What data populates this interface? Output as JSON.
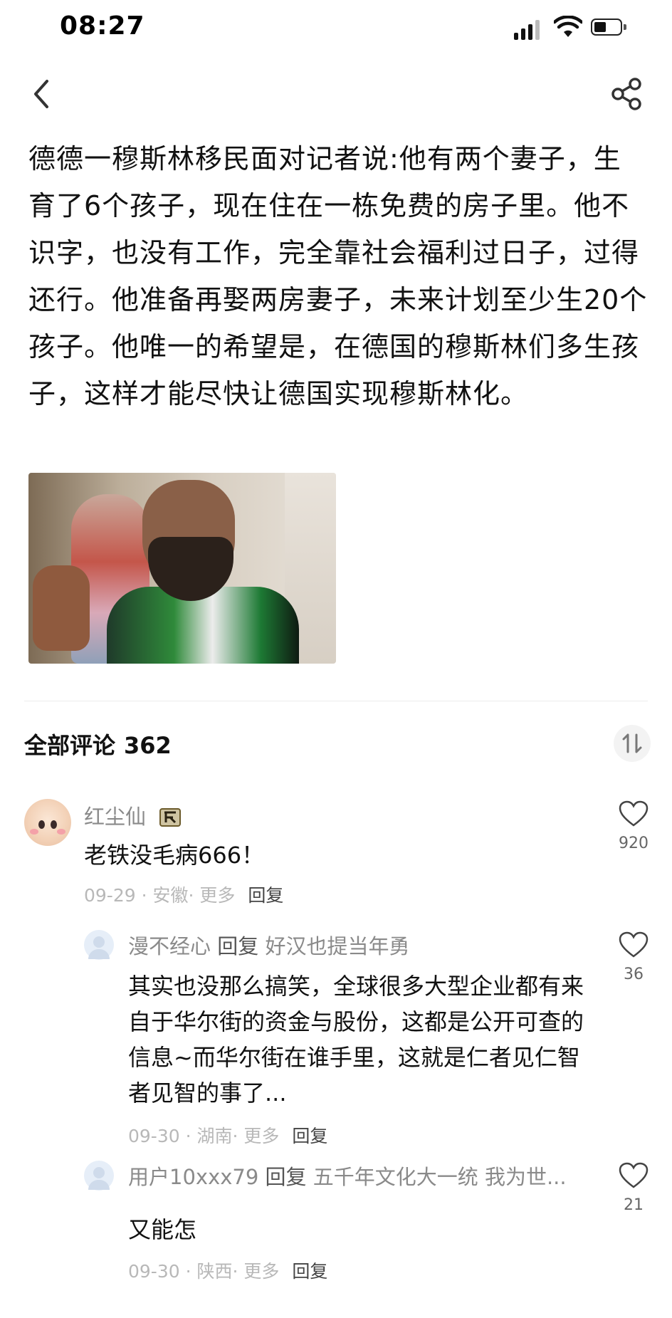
{
  "status_bar": {
    "time": "08:27"
  },
  "post": {
    "text": "德德一穆斯林移民面对记者说:他有两个妻子，生育了6个孩子，现在住在一栋免费的房子里。他不识字，也没有工作，完全靠社会福利过日子，过得还行。他准备再娶两房妻子，未来计划至少生20个孩子。他唯一的希望是，在德国的穆斯林们多生孩子，这样才能尽快让德国实现穆斯林化。"
  },
  "comments_header": {
    "label": "全部评论",
    "count": "362"
  },
  "comments": [
    {
      "user": "红尘仙",
      "text": "老铁没毛病666！",
      "date": "09-29",
      "location": "安徽",
      "more": "更多",
      "reply": "回复",
      "likes": "920"
    }
  ],
  "replies": [
    {
      "user": "漫不经心",
      "reply_word": "回复",
      "reply_to": "好汉也提当年勇",
      "text": "其实也没那么搞笑，全球很多大型企业都有来自于华尔街的资金与股份，这都是公开可查的信息~而华尔街在谁手里，这就是仁者见仁智者见智的事了...",
      "date": "09-30",
      "location": "湖南",
      "more": "更多",
      "reply": "回复",
      "likes": "36"
    },
    {
      "user": "用户10xxx79",
      "reply_word": "回复",
      "reply_to": "五千年文化大一统 我为世...",
      "text": "又能怎",
      "date": "09-30",
      "location": "陕西",
      "more": "更多",
      "reply": "回复",
      "likes": "21"
    }
  ],
  "colors": {
    "text": "#111111",
    "meta": "#b8b8b8",
    "username": "#8a8a8a",
    "link": "#6b7a99"
  },
  "icons": [
    "back-chevron-icon",
    "share-icon",
    "sort-icon",
    "heart-icon",
    "signal-icon",
    "wifi-icon",
    "battery-icon",
    "badge-icon"
  ]
}
